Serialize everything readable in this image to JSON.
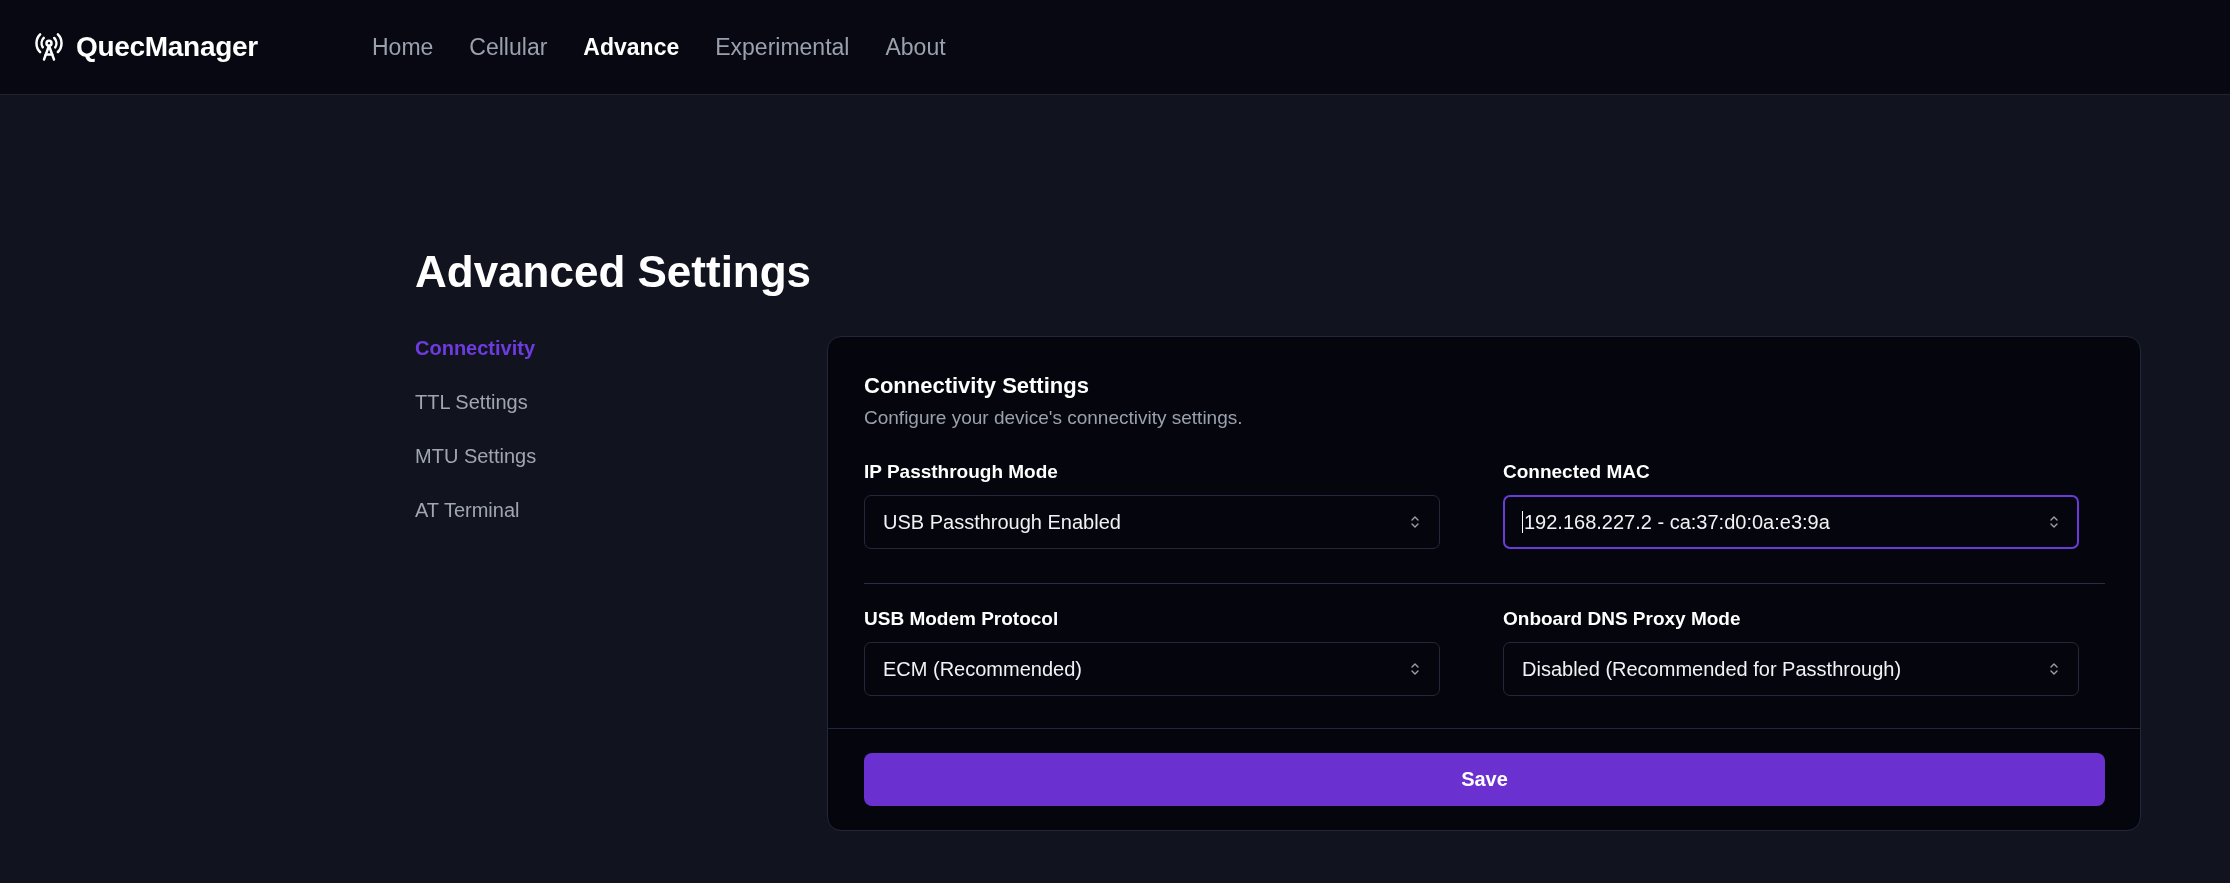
{
  "header": {
    "brand": "QuecManager",
    "nav": [
      {
        "label": "Home",
        "selected": false
      },
      {
        "label": "Cellular",
        "selected": false
      },
      {
        "label": "Advance",
        "selected": true
      },
      {
        "label": "Experimental",
        "selected": false
      },
      {
        "label": "About",
        "selected": false
      }
    ]
  },
  "page_title": "Advanced Settings",
  "sidebar": {
    "items": [
      {
        "label": "Connectivity",
        "selected": true
      },
      {
        "label": "TTL Settings",
        "selected": false
      },
      {
        "label": "MTU Settings",
        "selected": false
      },
      {
        "label": "AT Terminal",
        "selected": false
      }
    ]
  },
  "card": {
    "title": "Connectivity Settings",
    "description": "Configure your device's connectivity settings.",
    "sections": [
      {
        "fields": [
          {
            "label": "IP Passthrough Mode",
            "value": "USB Passthrough Enabled",
            "focused": false
          },
          {
            "label": "Connected MAC",
            "value": "192.168.227.2 - ca:37:d0:0a:e3:9a",
            "focused": true
          }
        ]
      },
      {
        "fields": [
          {
            "label": "USB Modem Protocol",
            "value": "ECM (Recommended)",
            "focused": false
          },
          {
            "label": "Onboard DNS Proxy Mode",
            "value": "Disabled (Recommended for Passthrough)",
            "focused": false
          }
        ]
      }
    ],
    "save_button": "Save"
  }
}
